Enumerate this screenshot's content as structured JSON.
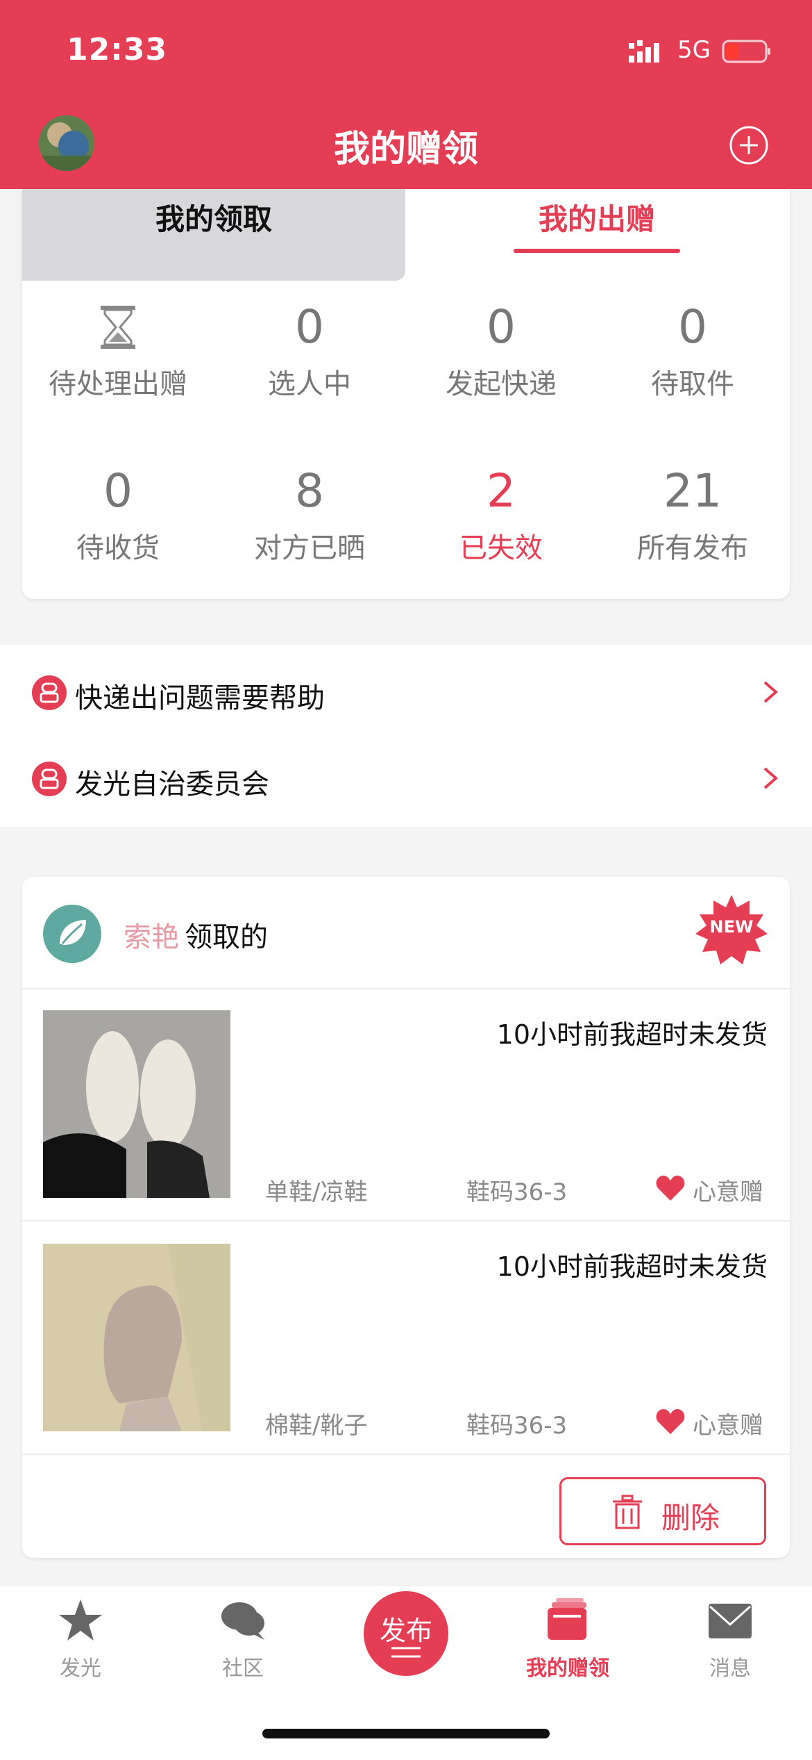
{
  "status_bar": {
    "time": "12:33",
    "network": "5G"
  },
  "header": {
    "title": "我的赠领"
  },
  "tabs": [
    {
      "label": "我的领取",
      "active": false
    },
    {
      "label": "我的出赠",
      "active": true
    }
  ],
  "stats": [
    {
      "label": "待处理出赠",
      "value": "",
      "icon": "hourglass-icon"
    },
    {
      "label": "选人中",
      "value": "0"
    },
    {
      "label": "发起快递",
      "value": "0"
    },
    {
      "label": "待取件",
      "value": "0"
    },
    {
      "label": "待收货",
      "value": "0"
    },
    {
      "label": "对方已晒",
      "value": "8"
    },
    {
      "label": "已失效",
      "value": "2",
      "highlight": true
    },
    {
      "label": "所有发布",
      "value": "21"
    }
  ],
  "menu": [
    {
      "label": "快递出问题需要帮助",
      "icon": "support-agent-icon"
    },
    {
      "label": "发光自治委员会",
      "icon": "support-agent-icon"
    }
  ],
  "feed": {
    "user_name": "索艳",
    "action": "领取的",
    "badge": "NEW",
    "items": [
      {
        "status": "10小时前我超时未发货",
        "category": "单鞋/凉鞋",
        "size": "鞋码36-3",
        "gift_type": "心意赠"
      },
      {
        "status": "10小时前我超时未发货",
        "category": "棉鞋/靴子",
        "size": "鞋码36-3",
        "gift_type": "心意赠"
      }
    ],
    "delete_label": "删除"
  },
  "bottom_nav": [
    {
      "label": "发光",
      "icon": "star-icon",
      "active": false
    },
    {
      "label": "社区",
      "icon": "chat-bubbles-icon",
      "active": false
    },
    {
      "label": "发布",
      "icon": "publish-icon",
      "active": false
    },
    {
      "label": "我的赠领",
      "icon": "gift-box-icon",
      "active": true
    },
    {
      "label": "消息",
      "icon": "mail-icon",
      "active": false
    }
  ],
  "colors": {
    "accent": "#e53d53",
    "muted": "#777777",
    "background": "#f4f4f4"
  }
}
